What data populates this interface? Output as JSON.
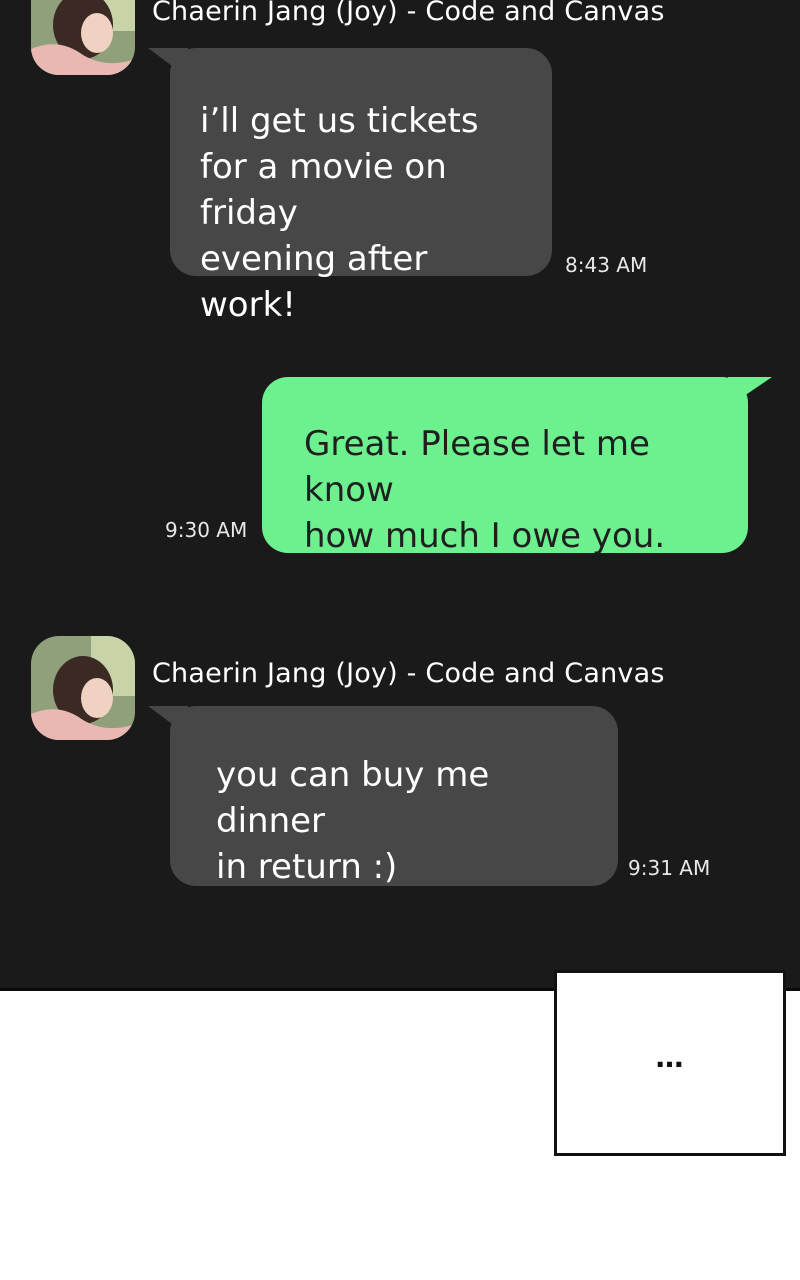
{
  "messages": [
    {
      "direction": "incoming",
      "sender": "Chaerin Jang (Joy) - Code and Canvas",
      "text": "i’ll get us tickets\nfor a movie on friday\nevening after work!",
      "time": "8:43 AM"
    },
    {
      "direction": "outgoing",
      "text": "Great. Please let me know\nhow much I owe you.",
      "time": "9:30 AM"
    },
    {
      "direction": "incoming",
      "sender": "Chaerin Jang (Joy) - Code and Canvas",
      "text": "you can buy me dinner\nin return :)",
      "time": "9:31 AM"
    }
  ],
  "ellipsis_box": {
    "text": "…"
  },
  "colors": {
    "chat_background": "#1a1a1a",
    "incoming_bubble": "#474747",
    "outgoing_bubble": "#6df08e",
    "page_background": "#ffffff"
  },
  "icons": {
    "avatar": "avatar-icon"
  }
}
